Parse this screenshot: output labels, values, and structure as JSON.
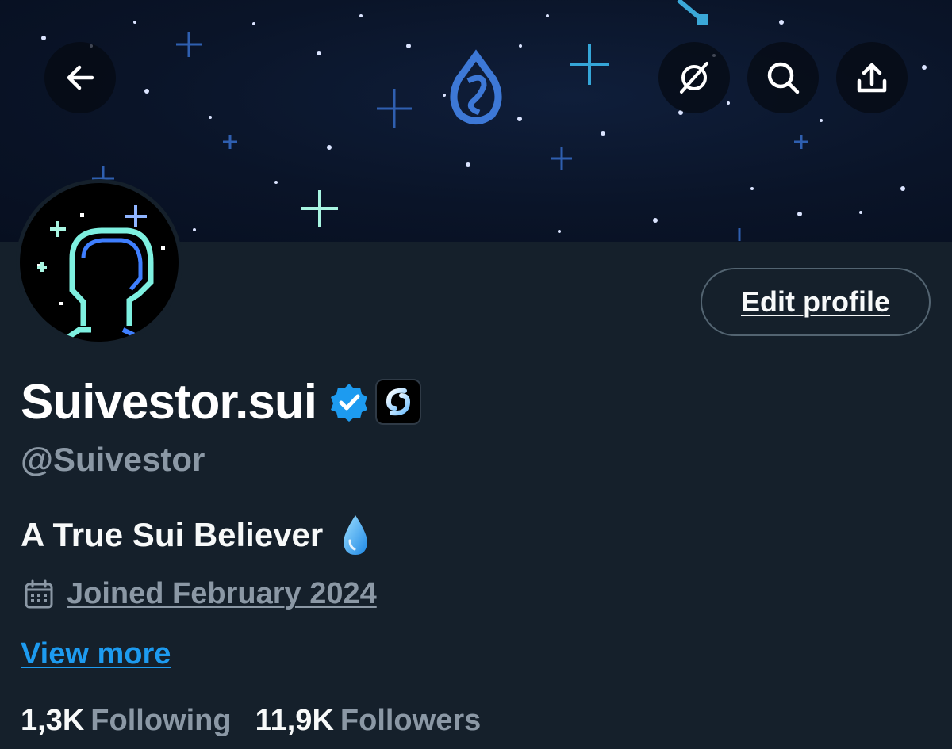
{
  "header": {
    "back_icon": "arrow-left-icon",
    "actions": [
      "no-reply-icon",
      "search-icon",
      "share-icon"
    ]
  },
  "profile": {
    "display_name": "Suivestor.sui",
    "handle": "@Suivestor",
    "verified_color": "#1d9bf0",
    "edit_button_label": "Edit profile",
    "bio": "A True Sui Believer",
    "bio_emoji": "droplet-emoji",
    "joined_icon": "calendar-icon",
    "joined_text": "Joined February 2024",
    "view_more_label": "View more"
  },
  "stats": {
    "following_count": "1,3K",
    "following_label": "Following",
    "followers_count": "11,9K",
    "followers_label": "Followers"
  },
  "colors": {
    "background": "#15202b",
    "secondary_text": "#8b98a5",
    "accent": "#1d9bf0"
  }
}
